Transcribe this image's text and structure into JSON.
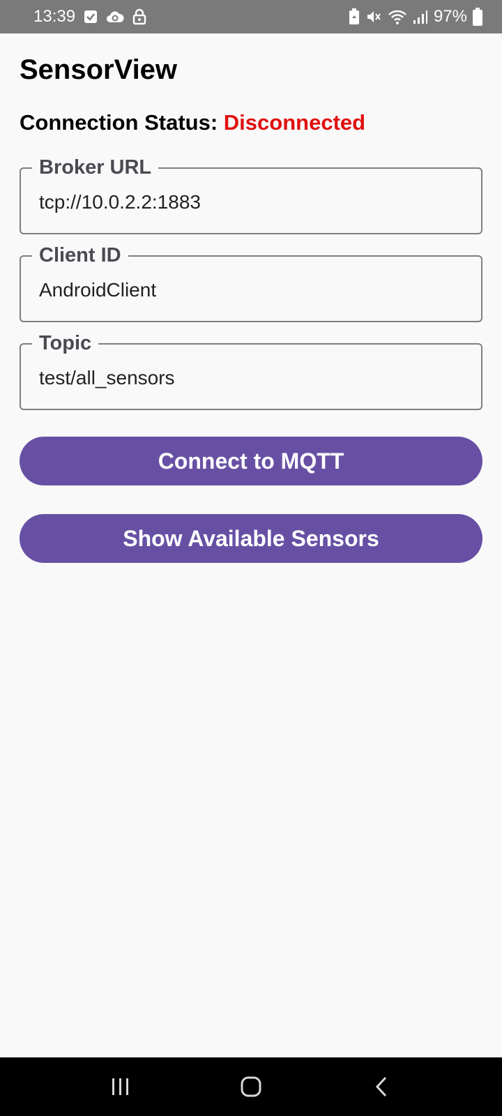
{
  "status_bar": {
    "time": "13:39",
    "battery_percent": "97%",
    "battery_level": 0.97,
    "left_icons": [
      "checkbox-icon",
      "cloud-sync-icon",
      "lock-icon"
    ],
    "right_icons": [
      "battery-saver-icon",
      "mute-vibrate-icon",
      "wifi-icon",
      "cellular-signal-icon",
      "battery-icon"
    ]
  },
  "app": {
    "title": "SensorView"
  },
  "connection": {
    "label": "Connection Status:",
    "value": "Disconnected",
    "value_color": "#e01010"
  },
  "fields": {
    "broker_url": {
      "label": "Broker URL",
      "value": "tcp://10.0.2.2:1883"
    },
    "client_id": {
      "label": "Client ID",
      "value": "AndroidClient"
    },
    "topic": {
      "label": "Topic",
      "value": "test/all_sensors"
    }
  },
  "buttons": {
    "connect": "Connect to MQTT",
    "show_sensors": "Show Available Sensors"
  },
  "colors": {
    "accent": "#6750a4",
    "status_bar": "#7a7a7a",
    "background": "#f9f9f9"
  },
  "nav_bar": {
    "icons": [
      "recent-apps-icon",
      "home-icon",
      "back-icon"
    ]
  }
}
